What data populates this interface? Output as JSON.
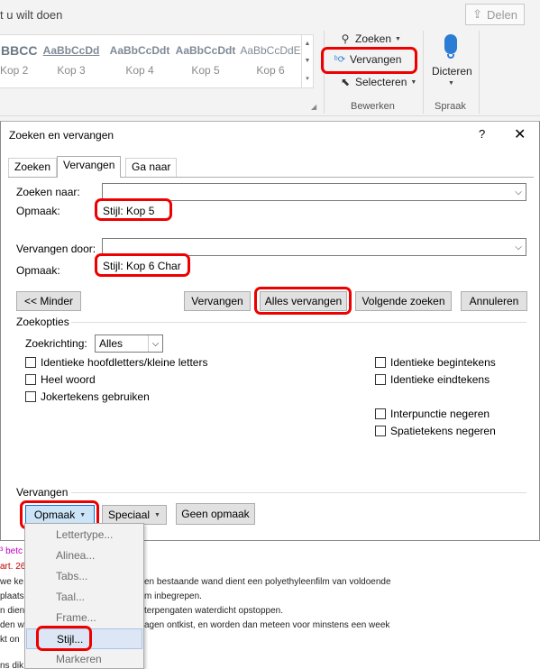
{
  "ribbon": {
    "tell_me": "t u wilt doen",
    "share_label": "Delen",
    "styles": [
      {
        "sample": "BBCC",
        "name": "Kop 2"
      },
      {
        "sample": "AaBbCcDd",
        "name": "Kop 3"
      },
      {
        "sample": "AaBbCcDdt",
        "name": "Kop 4"
      },
      {
        "sample": "AaBbCcDdt",
        "name": "Kop 5"
      },
      {
        "sample": "AaBbCcDdE",
        "name": "Kop 6"
      }
    ],
    "zoeken": "Zoeken",
    "vervangen": "Vervangen",
    "selecteren": "Selecteren",
    "bewerken": "Bewerken",
    "dicteren": "Dicteren",
    "spraak": "Spraak"
  },
  "dialog": {
    "title": "Zoeken en vervangen",
    "help": "?",
    "close": "✕",
    "tabs": [
      "Zoeken",
      "Vervangen",
      "Ga naar"
    ],
    "find_label": "Zoeken naar:",
    "find_value": "",
    "format_label": "Opmaak:",
    "find_format": "Stijl: Kop 5",
    "replace_label": "Vervangen door:",
    "replace_value": "",
    "replace_format_label": "Opmaak:",
    "replace_format": "Stijl: Kop 6 Char",
    "buttons": {
      "less": "<< Minder",
      "replace": "Vervangen",
      "replace_all": "Alles vervangen",
      "find_next": "Volgende zoeken",
      "cancel": "Annuleren"
    },
    "search_options_title": "Zoekopties",
    "direction_label": "Zoekrichting:",
    "direction_value": "Alles",
    "checks_left": [
      "Identieke hoofdletters/kleine letters",
      "Heel woord",
      "Jokertekens gebruiken"
    ],
    "checks_right": [
      "Identieke begintekens",
      "Identieke eindtekens",
      "Interpunctie negeren",
      "Spatietekens negeren"
    ],
    "replace_section_title": "Vervangen",
    "bottom_buttons": {
      "format": "Opmaak",
      "special": "Speciaal",
      "no_format": "Geen opmaak"
    }
  },
  "format_menu": {
    "items": [
      "Lettertype...",
      "Alinea...",
      "Tabs...",
      "Taal...",
      "Frame...",
      "Stijl...",
      "Markeren"
    ]
  },
  "document": {
    "lines": [
      "³ betc",
      "art. 26",
      "we ke",
      "plaats",
      "n dien",
      "den w",
      "kt on",
      "ns dik"
    ],
    "line_right": [
      "",
      "",
      "en bestaande wand dient een polyethyleenfilm van voldoende",
      "m inbegrepen.",
      "terpengaten waterdicht opstoppen.",
      "agen ontkist, en worden dan meteen voor minstens een week",
      "",
      ""
    ]
  }
}
